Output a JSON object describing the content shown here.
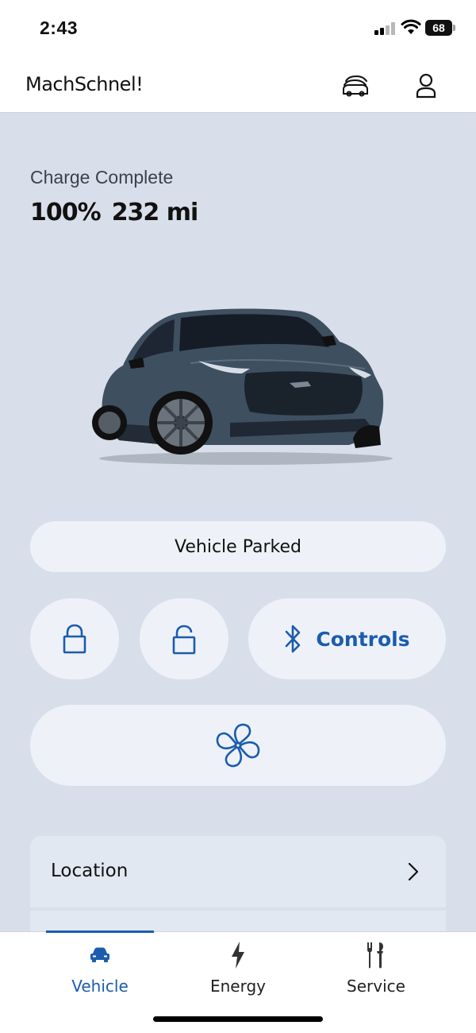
{
  "status_bar": {
    "time": "2:43",
    "battery_level": "68"
  },
  "header": {
    "title": "MachSchnel!",
    "icons": [
      "vehicle-switcher-icon",
      "account-icon"
    ]
  },
  "vehicle": {
    "charge_status": "Charge Complete",
    "charge_percent": "100%",
    "range": "232 mi",
    "state": "Vehicle Parked"
  },
  "controls": {
    "lock_icon": "lock-icon",
    "unlock_icon": "unlock-icon",
    "bluetooth_icon": "bluetooth-icon",
    "controls_label": "Controls",
    "climate_icon": "fan-icon"
  },
  "list": {
    "location_label": "Location"
  },
  "nav": {
    "tabs": [
      {
        "label": "Vehicle",
        "icon": "car-icon",
        "active": true
      },
      {
        "label": "Energy",
        "icon": "lightning-icon",
        "active": false
      },
      {
        "label": "Service",
        "icon": "tools-icon",
        "active": false
      }
    ]
  },
  "colors": {
    "accent": "#1b5cae",
    "background": "#d8dfea",
    "button_bg": "#eef2f8",
    "car_body": "#3e4f60"
  }
}
